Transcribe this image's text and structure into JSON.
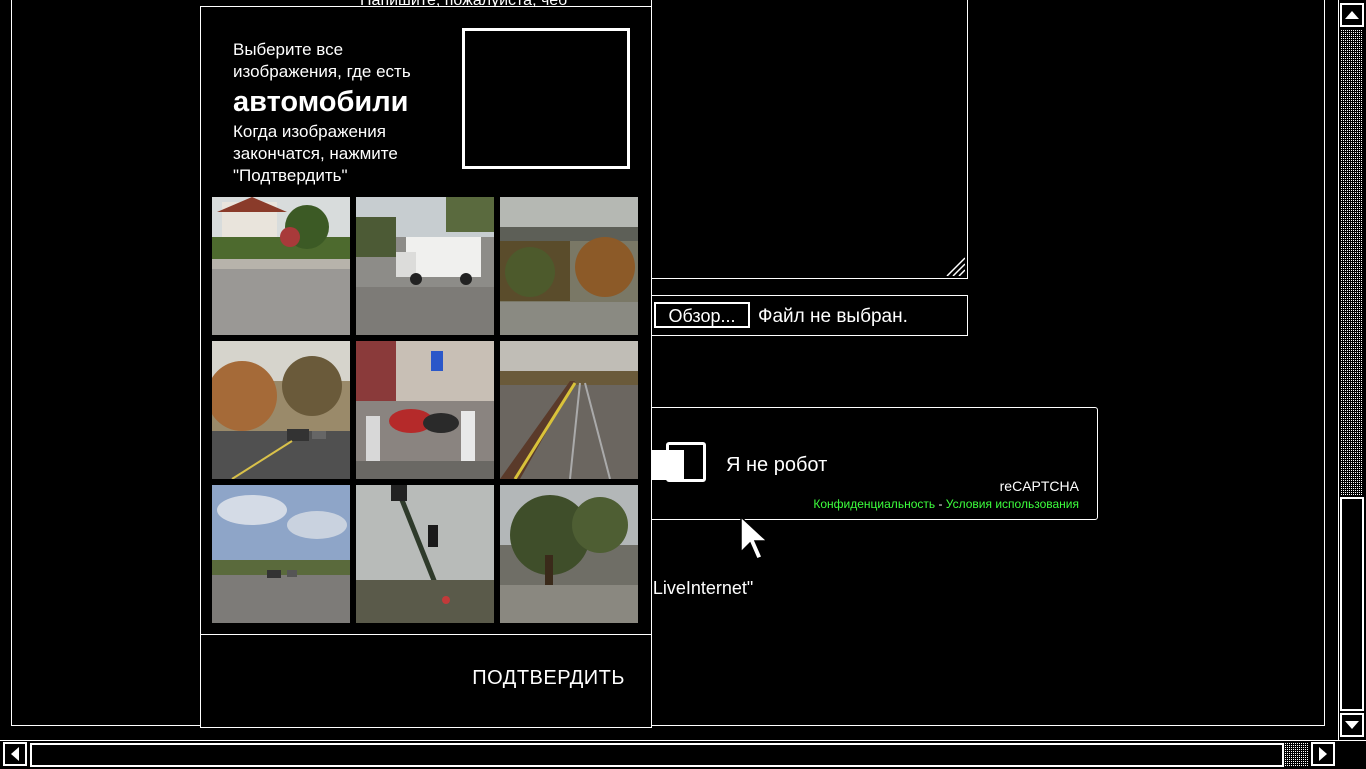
{
  "page": {
    "top_fragment": "Напишите, пожалуйста, чеб",
    "file_input": {
      "button_label": "Обзор...",
      "status": "Файл не выбран."
    },
    "recaptcha": {
      "label": "Я не робот",
      "brand": "reCAPTCHA",
      "privacy_link": "Конфиденциальность",
      "separator": " - ",
      "terms_link": "Условия использования",
      "link_color": "#3dff3d"
    },
    "live_text": "к LiveInternet\""
  },
  "challenge": {
    "instruction_prefix": "Выберите все изображения, где есть",
    "object": "автомобили",
    "instruction_suffix": "Когда изображения закончатся, нажмите \"Подтвердить\"",
    "confirm_label": "ПОДТВЕРДИТЬ",
    "tiles": [
      {
        "name": "tile-1",
        "desc_icon": "street-house-image"
      },
      {
        "name": "tile-2",
        "desc_icon": "truck-road-image"
      },
      {
        "name": "tile-3",
        "desc_icon": "overpass-trees-image"
      },
      {
        "name": "tile-4",
        "desc_icon": "road-cars-image"
      },
      {
        "name": "tile-5",
        "desc_icon": "motorcycles-people-image"
      },
      {
        "name": "tile-6",
        "desc_icon": "railway-image"
      },
      {
        "name": "tile-7",
        "desc_icon": "highway-sky-image"
      },
      {
        "name": "tile-8",
        "desc_icon": "traffic-light-image"
      },
      {
        "name": "tile-9",
        "desc_icon": "tree-road-image"
      }
    ]
  }
}
